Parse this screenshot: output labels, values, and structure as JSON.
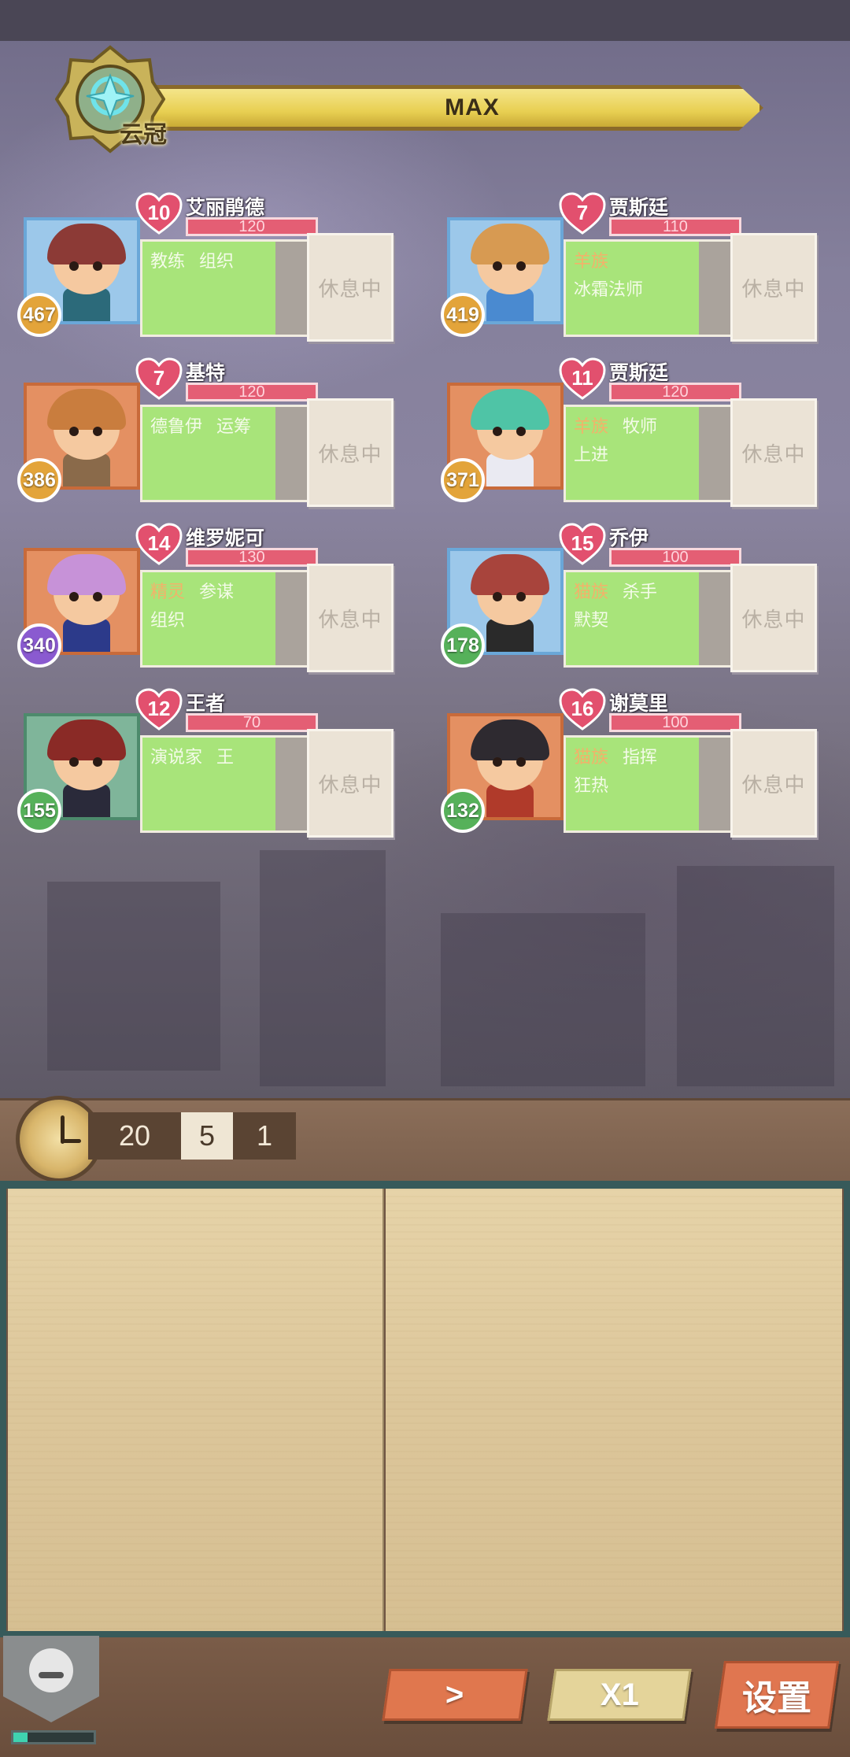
{
  "header": {
    "rank_label": "云冠",
    "progress_label": "MAX"
  },
  "characters": [
    {
      "name": "艾丽鹃德",
      "heart": "10",
      "hp": "120",
      "level": "467",
      "traits": [
        {
          "text": "教练",
          "race": false
        },
        {
          "text": "组织",
          "race": false
        }
      ],
      "status": "休息中"
    },
    {
      "name": "贾斯廷",
      "heart": "7",
      "hp": "110",
      "level": "419",
      "traits": [
        {
          "text": "羊族",
          "race": true
        },
        {
          "text": "冰霜法师",
          "race": false
        }
      ],
      "status": "休息中"
    },
    {
      "name": "基特",
      "heart": "7",
      "hp": "120",
      "level": "386",
      "traits": [
        {
          "text": "德鲁伊",
          "race": false
        },
        {
          "text": "运筹",
          "race": false
        }
      ],
      "status": "休息中"
    },
    {
      "name": "贾斯廷",
      "heart": "11",
      "hp": "120",
      "level": "371",
      "traits": [
        {
          "text": "羊族",
          "race": true
        },
        {
          "text": "牧师",
          "race": false
        },
        {
          "text": "上进",
          "race": false
        }
      ],
      "status": "休息中"
    },
    {
      "name": "维罗妮可",
      "heart": "14",
      "hp": "130",
      "level": "340",
      "traits": [
        {
          "text": "精灵",
          "race": true
        },
        {
          "text": "参谋",
          "race": false
        },
        {
          "text": "组织",
          "race": false
        }
      ],
      "status": "休息中"
    },
    {
      "name": "乔伊",
      "heart": "15",
      "hp": "100",
      "level": "178",
      "traits": [
        {
          "text": "猫族",
          "race": true
        },
        {
          "text": "杀手",
          "race": false
        },
        {
          "text": "默契",
          "race": false
        }
      ],
      "status": "休息中"
    },
    {
      "name": "王者",
      "heart": "12",
      "hp": "70",
      "level": "155",
      "traits": [
        {
          "text": "演说家",
          "race": false
        },
        {
          "text": "王",
          "race": false
        }
      ],
      "status": "休息中"
    },
    {
      "name": "谢莫里",
      "heart": "16",
      "hp": "100",
      "level": "132",
      "traits": [
        {
          "text": "猫族",
          "race": true
        },
        {
          "text": "指挥",
          "race": false
        },
        {
          "text": "狂热",
          "race": false
        }
      ],
      "status": "休息中"
    }
  ],
  "hud": {
    "counter_a": "20",
    "counter_b": "5",
    "counter_c": "1"
  },
  "footer": {
    "next_label": ">",
    "speed_label": "X1",
    "settings_label": "设置",
    "progress_fraction": 0.18
  },
  "colors": {
    "level_badges": [
      "#e3a43a",
      "#e3a43a",
      "#e3a43a",
      "#e3a43a",
      "#8a5ad0",
      "#56b15a",
      "#56b15a",
      "#56b15a"
    ],
    "hp": "#e45e74",
    "panel": "#a8e47a"
  }
}
